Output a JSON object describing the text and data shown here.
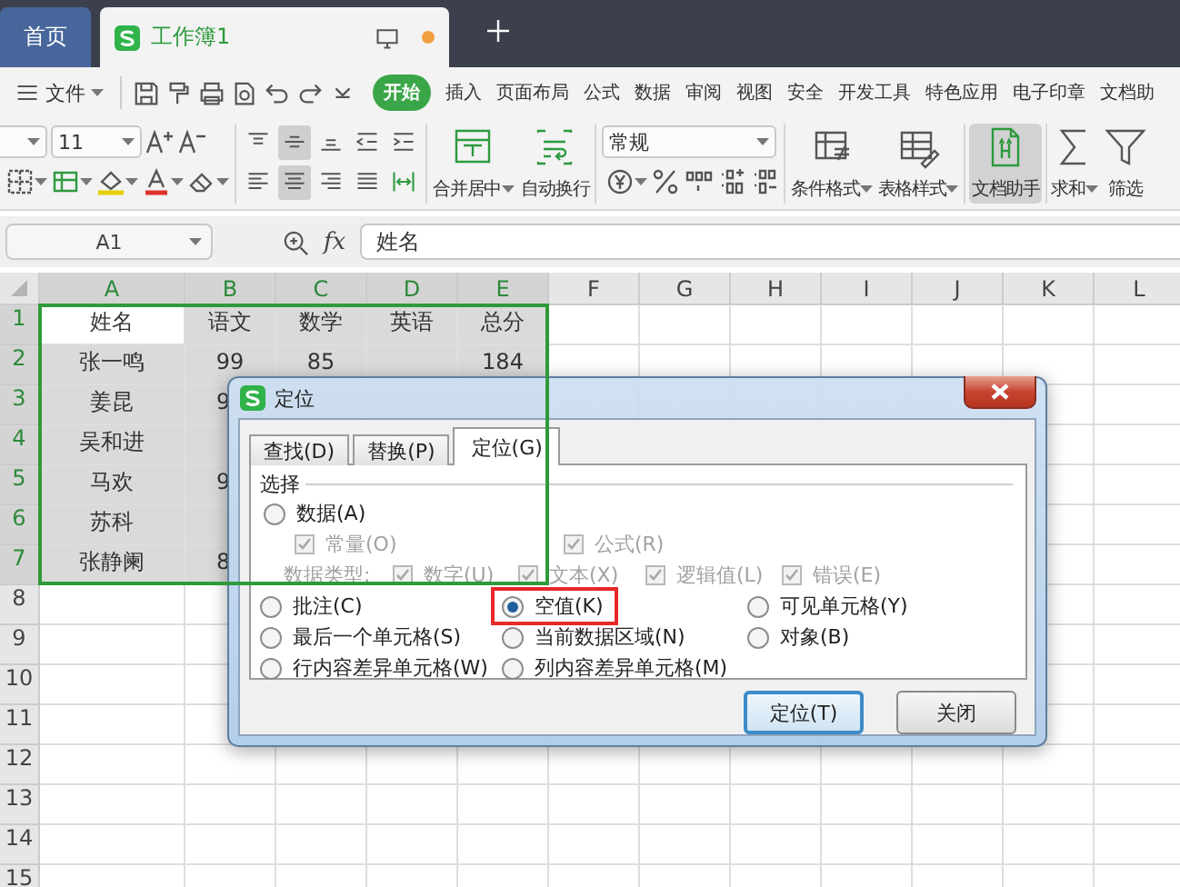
{
  "tabs": [
    {
      "label": "首页",
      "kind": "home",
      "selected": false
    },
    {
      "label": "工作簿1",
      "kind": "doc",
      "selected": true
    }
  ],
  "menu": {
    "file_label": "文件",
    "tabs": [
      {
        "label": "开始",
        "selected": true
      },
      {
        "label": "插入",
        "selected": false
      },
      {
        "label": "页面布局",
        "selected": false
      },
      {
        "label": "公式",
        "selected": false
      },
      {
        "label": "数据",
        "selected": false
      },
      {
        "label": "审阅",
        "selected": false
      },
      {
        "label": "视图",
        "selected": false
      },
      {
        "label": "安全",
        "selected": false
      },
      {
        "label": "开发工具",
        "selected": false
      },
      {
        "label": "特色应用",
        "selected": false
      },
      {
        "label": "电子印章",
        "selected": false
      },
      {
        "label": "文档助",
        "selected": false
      }
    ]
  },
  "ribbon": {
    "font_size": "11",
    "align_buttons": [
      {
        "kind": "top",
        "pressed": false
      },
      {
        "kind": "middle",
        "pressed": true
      },
      {
        "kind": "bottom",
        "pressed": false
      },
      {
        "kind": "outdent",
        "pressed": false
      },
      {
        "kind": "indent",
        "pressed": false
      },
      {
        "kind": "left",
        "pressed": false
      },
      {
        "kind": "center",
        "pressed": true
      },
      {
        "kind": "right",
        "pressed": false
      },
      {
        "kind": "justify",
        "pressed": false
      },
      {
        "kind": "distribute",
        "pressed": false
      }
    ],
    "number_format": "常规",
    "buttons": [
      {
        "label": "合并居中",
        "kind": "merge",
        "dropdown": true,
        "pressed": false
      },
      {
        "label": "自动换行",
        "kind": "wrap",
        "dropdown": false,
        "pressed": false
      },
      {
        "label": "条件格式",
        "kind": "conditional",
        "dropdown": true,
        "pressed": false
      },
      {
        "label": "表格样式",
        "kind": "tablestyle",
        "dropdown": true,
        "pressed": false
      },
      {
        "label": "文档助手",
        "kind": "assistant",
        "dropdown": false,
        "pressed": true
      },
      {
        "label": "求和",
        "kind": "sum",
        "dropdown": true,
        "pressed": false
      },
      {
        "label": "筛选",
        "kind": "filter",
        "dropdown": false,
        "pressed": false
      }
    ]
  },
  "formula_bar": {
    "name_box": "A1",
    "function_label": "fx",
    "formula": "姓名"
  },
  "sheet": {
    "columns": [
      {
        "label": "A",
        "selected": true
      },
      {
        "label": "B",
        "selected": true
      },
      {
        "label": "C",
        "selected": true
      },
      {
        "label": "D",
        "selected": true
      },
      {
        "label": "E",
        "selected": true
      },
      {
        "label": "F",
        "selected": false
      },
      {
        "label": "G",
        "selected": false
      },
      {
        "label": "H",
        "selected": false
      },
      {
        "label": "I",
        "selected": false
      },
      {
        "label": "J",
        "selected": false
      },
      {
        "label": "K",
        "selected": false
      },
      {
        "label": "L",
        "selected": false
      }
    ],
    "rows": [
      {
        "label": "1",
        "selected": true,
        "cells": [
          "姓名",
          "语文",
          "数学",
          "英语",
          "总分"
        ]
      },
      {
        "label": "2",
        "selected": true,
        "cells": [
          "张一鸣",
          "99",
          "85",
          null,
          "184"
        ]
      },
      {
        "label": "3",
        "selected": true,
        "cells": [
          "姜昆",
          {
            "text": "9",
            "clipped": true
          }
        ]
      },
      {
        "label": "4",
        "selected": true,
        "cells": [
          "吴和进"
        ]
      },
      {
        "label": "5",
        "selected": true,
        "cells": [
          "马欢",
          {
            "text": "9",
            "clipped": true
          }
        ]
      },
      {
        "label": "6",
        "selected": true,
        "cells": [
          "苏科"
        ]
      },
      {
        "label": "7",
        "selected": true,
        "cells": [
          "张静阑",
          {
            "text": "8",
            "clipped": true
          }
        ]
      },
      {
        "label": "8",
        "selected": false,
        "cells": []
      },
      {
        "label": "9",
        "selected": false,
        "cells": []
      },
      {
        "label": "10",
        "selected": false,
        "cells": []
      },
      {
        "label": "11",
        "selected": false,
        "cells": []
      },
      {
        "label": "12",
        "selected": false,
        "cells": []
      },
      {
        "label": "13",
        "selected": false,
        "cells": []
      },
      {
        "label": "14",
        "selected": false,
        "cells": []
      },
      {
        "label": "15",
        "selected": false,
        "cells": []
      }
    ]
  },
  "dialog": {
    "title": "定位",
    "tabs": [
      {
        "label": "查找(D)",
        "selected": false
      },
      {
        "label": "替换(P)",
        "selected": false
      },
      {
        "label": "定位(G)",
        "selected": true
      }
    ],
    "group_label": "选择",
    "data_option": {
      "label": "数据(A)",
      "selected": false
    },
    "formula_options": [
      {
        "label": "常量(O)",
        "checked": true,
        "disabled": true
      },
      {
        "label": "公式(R)",
        "checked": true,
        "disabled": true
      }
    ],
    "data_type_label": "数据类型:",
    "data_types": [
      {
        "label": "数字(U)",
        "checked": true,
        "disabled": true
      },
      {
        "label": "文本(X)",
        "checked": true,
        "disabled": true
      },
      {
        "label": "逻辑值(L)",
        "checked": true,
        "disabled": true
      },
      {
        "label": "错误(E)",
        "checked": true,
        "disabled": true
      }
    ],
    "options": [
      {
        "label": "批注(C)",
        "selected": false,
        "highlighted": false
      },
      {
        "label": "空值(K)",
        "selected": true,
        "highlighted": true
      },
      {
        "label": "可见单元格(Y)",
        "selected": false,
        "highlighted": false
      },
      {
        "label": "最后一个单元格(S)",
        "selected": false,
        "highlighted": false
      },
      {
        "label": "当前数据区域(N)",
        "selected": false,
        "highlighted": false
      },
      {
        "label": "对象(B)",
        "selected": false,
        "highlighted": false
      },
      {
        "label": "行内容差异单元格(W)",
        "selected": false,
        "highlighted": false
      },
      {
        "label": "列内容差异单元格(M)",
        "selected": false,
        "highlighted": false
      }
    ],
    "buttons": [
      {
        "label": "定位(T)",
        "default": true
      },
      {
        "label": "关闭",
        "default": false
      }
    ]
  }
}
